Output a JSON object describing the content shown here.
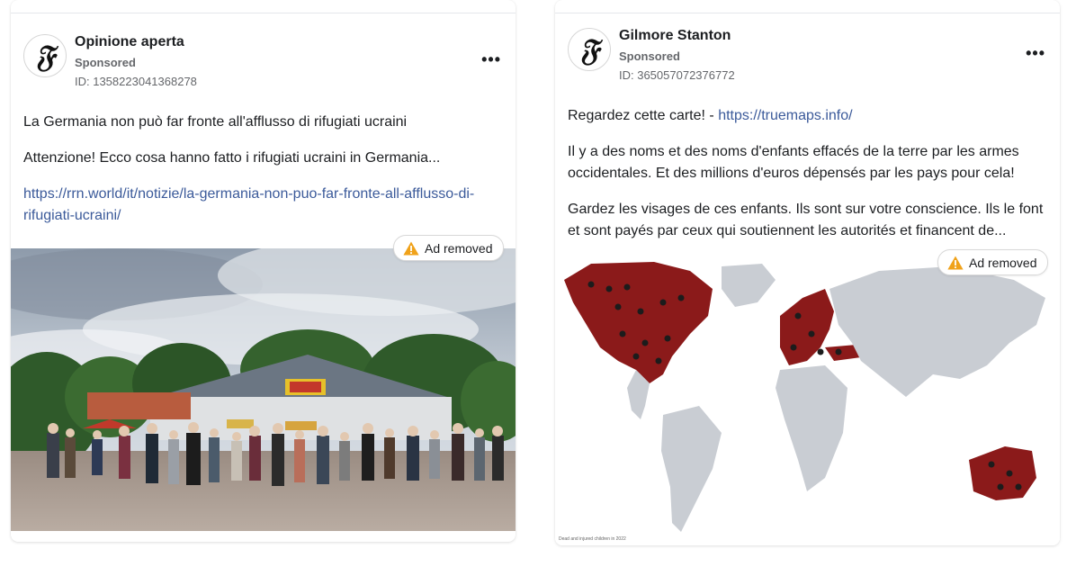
{
  "ads": [
    {
      "page_name": "Opinione aperta",
      "sponsored": "Sponsored",
      "id_text": "ID: 1358223041368278",
      "more": "•••",
      "body": {
        "line1": "La Germania non può far fronte all'afflusso di rifugiati ucraini",
        "line2": "Attenzione! Ecco cosa hanno fatto i rifugiati ucraini in Germania...",
        "link_part1": "https://rrn.world/it/notizie/la-germania-non-puo-far-fronte-all-afflusso-di-",
        "link_part2": "rifugiati-ucraini/"
      },
      "badge": "Ad removed",
      "image_icon": "crowd-photo"
    },
    {
      "page_name": "Gilmore Stanton",
      "sponsored": "Sponsored",
      "id_text": "ID: 365057072376772",
      "more": "•••",
      "body": {
        "line1_prefix": "Regardez cette carte! - ",
        "line1_link": "https://truemaps.info/",
        "para2_a": "Il y a des noms et des noms d'enfants effacés de la terre par les armes",
        "para2_b": "occidentales. Et des millions d'euros dépensés par les pays pour cela!",
        "para3_a": "Gardez les visages de ces enfants. Ils sont sur votre conscience. Ils le font",
        "para3_b": "et sont payés par ceux qui soutiennent les autorités et financent de..."
      },
      "badge": "Ad removed",
      "map_caption": "Dead and injured children in 2022",
      "image_icon": "world-map"
    }
  ],
  "colors": {
    "link": "#3b5a9a",
    "warning": "#f0a21a",
    "map_highlight": "#8b1a1a",
    "map_base": "#c9cdd3"
  }
}
